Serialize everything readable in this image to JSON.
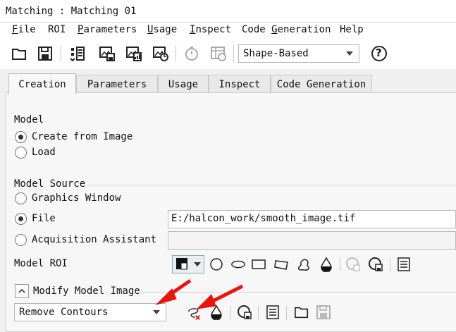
{
  "window": {
    "title": "Matching : Matching 01"
  },
  "menu": [
    {
      "label": "File",
      "u": "F",
      "rest": "ile"
    },
    {
      "label": "ROI",
      "u": "",
      "rest": "ROI"
    },
    {
      "label": "Parameters",
      "u": "P",
      "rest": "arameters"
    },
    {
      "label": "Usage",
      "u": "U",
      "rest": "sage"
    },
    {
      "label": "Inspect",
      "u": "I",
      "rest": "nspect"
    },
    {
      "label": "Code Generation",
      "u": "",
      "rest": "Code "
    },
    {
      "label": "Help",
      "u": "",
      "rest": "Help"
    }
  ],
  "toolbar": {
    "icons": [
      "open-folder-icon",
      "save-icon",
      "parameter-list-icon",
      "image-save-icon",
      "image-chart-icon",
      "image-refresh-icon",
      "stopwatch-icon",
      "table-clock-icon",
      "help-icon"
    ],
    "method_select": "Shape-Based",
    "help_label": "?"
  },
  "tabs": [
    "Creation",
    "Parameters",
    "Usage",
    "Inspect",
    "Code Generation"
  ],
  "creation": {
    "model_heading": "Model",
    "model_options": [
      "Create from Image",
      "Load"
    ],
    "model_selected": 0,
    "source_heading": "Model Source",
    "source_options": [
      "Graphics Window",
      "File",
      "Acquisition Assistant"
    ],
    "source_selected": 1,
    "file_path": "E:/halcon_work/smooth_image.tif",
    "acq_value": "",
    "roi_label": "Model ROI",
    "roi_icons": [
      "draw-mode-icon",
      "circle-icon",
      "ellipse-icon",
      "rectangle-icon",
      "rotated-rectangle-icon",
      "freeform-icon",
      "droplet-icon",
      "roi-add-icon",
      "roi-load-icon",
      "roi-list-icon"
    ],
    "modify_heading": "Modify Model Image",
    "modify_select": "Remove Contours",
    "modify_icons": [
      "remove-contour-icon",
      "droplet-icon",
      "roi-load-icon",
      "list-icon",
      "open-folder-icon",
      "save-icon"
    ]
  },
  "colors": {
    "accent": "#e8150f",
    "panel": "#f7f7f7"
  }
}
